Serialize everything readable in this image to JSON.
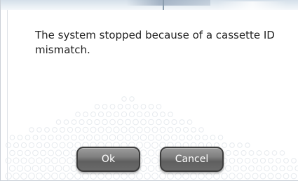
{
  "dialog": {
    "message": "The system stopped because of a cassette ID mismatch.",
    "ok_label": "Ok",
    "cancel_label": "Cancel"
  },
  "colors": {
    "button": "#6f6f6f",
    "button_border": "#3c3c3c",
    "button_text": "#ffffff",
    "message_text": "#1f1f1f",
    "title_strip": "#dde6ee"
  }
}
